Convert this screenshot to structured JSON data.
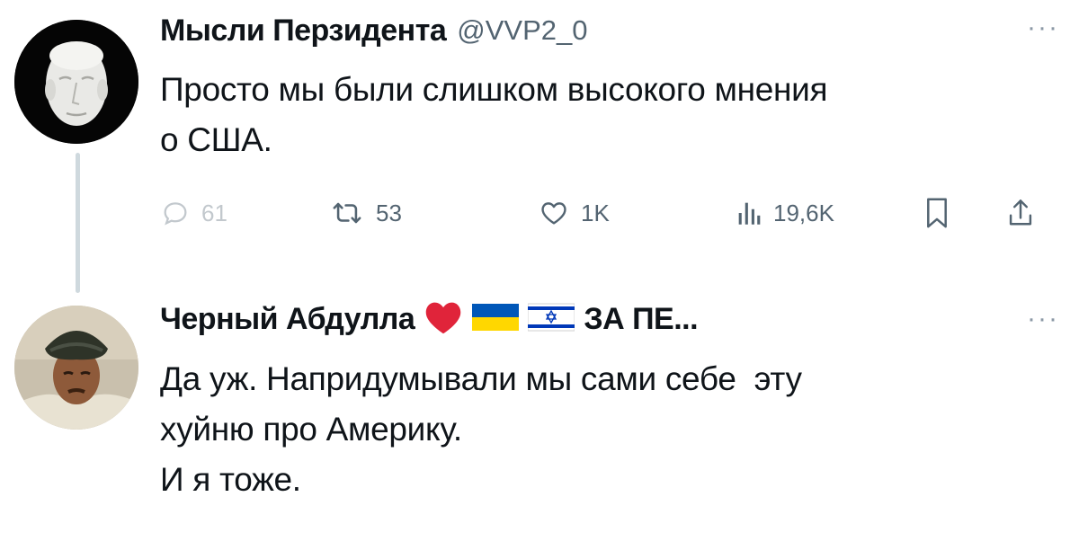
{
  "tweets": [
    {
      "author_name": "Мысли Перзидента",
      "handle": "@VVP2_0",
      "more": "···",
      "text_lines": [
        "Просто мы были слишком высокого мнения",
        "о США."
      ],
      "actions": {
        "reply_count": "61",
        "retweet_count": "53",
        "like_count": "1K",
        "views_count": "19,6K"
      }
    },
    {
      "author_name": "Черный Абдулла",
      "name_suffix": "ЗА ПЕ...",
      "badges": [
        "heart",
        "flag-ukraine",
        "flag-israel"
      ],
      "more": "···",
      "text_lines": [
        "Да уж. Напридумывали мы сами себе  эту",
        "хуйню про Америку.",
        "И я тоже."
      ]
    }
  ],
  "colors": {
    "text": "#0f1419",
    "secondary": "#536471",
    "thread_line": "#cfd9de",
    "heart": "#e0243a",
    "ukraine_blue": "#0057b8",
    "ukraine_yellow": "#ffd700",
    "israel_blue": "#0038b8"
  }
}
